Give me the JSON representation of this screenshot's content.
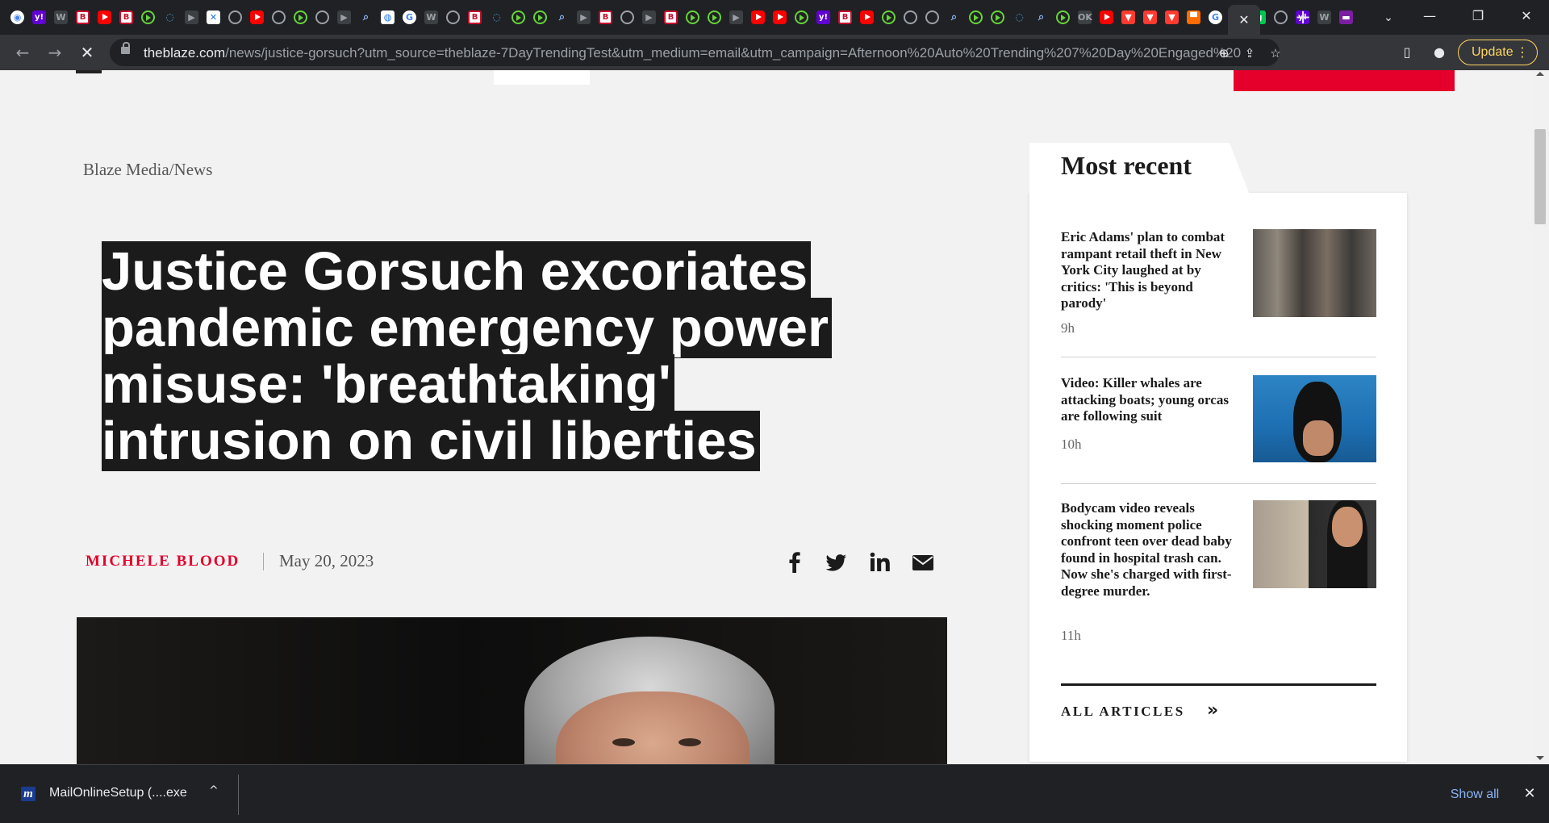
{
  "browser": {
    "tab_favicons": [
      "chrome",
      "yahoo",
      "wsj",
      "blaze",
      "youtube",
      "blaze",
      "rumble",
      "shield",
      "dark",
      "maps",
      "globe",
      "youtube",
      "globe",
      "rumble",
      "globe",
      "dark",
      "search",
      "earth",
      "google",
      "wsj",
      "globe",
      "blaze",
      "shield",
      "rumble",
      "rumble",
      "search",
      "dark",
      "blaze",
      "globe",
      "dark",
      "blaze",
      "rumble",
      "rumble",
      "dark",
      "youtube",
      "youtube",
      "rumble",
      "yahoo",
      "blaze",
      "youtube",
      "rumble",
      "globe",
      "globe",
      "search",
      "rumble",
      "rumble",
      "shield",
      "search",
      "rumble",
      "ok",
      "youtube",
      "dailymail",
      "dailymail",
      "dailymail",
      "orange",
      "google",
      "black",
      "green",
      "globe",
      "yahoo",
      "wsj",
      "purple"
    ],
    "active_tab_close": "✕",
    "new_tab": "+",
    "tab_search": "⌄",
    "window_controls": {
      "minimize": "—",
      "restore": "❐",
      "close": "✕"
    },
    "nav": {
      "back": "←",
      "forward": "→",
      "stop": "✕"
    },
    "url": {
      "domain": "theblaze.com",
      "path": "/news/justice-gorsuch?utm_source=theblaze-7DayTrendingTest&utm_medium=email&utm_campaign=Afternoon%20Auto%20Trending%207%20Day%20Engaged%202..."
    },
    "omnibox_icons": [
      "zoom-icon",
      "share-icon",
      "bookmark-star-icon"
    ],
    "toolbar_icons": [
      "side-panel-icon",
      "profile-icon"
    ],
    "update_label": "Update",
    "menu_dots": "⋮"
  },
  "article": {
    "breadcrumb": "Blaze Media/News",
    "headline": "Justice Gorsuch excoriates pandemic emergency power misuse:  'breathtaking' intrusion on civil liberties",
    "author": "Michele Blood",
    "date": "May 20, 2023",
    "share_icons": [
      "facebook-icon",
      "twitter-icon",
      "linkedin-icon",
      "email-icon"
    ]
  },
  "sidebar": {
    "title": "Most recent",
    "items": [
      {
        "title": "Eric Adams' plan to combat rampant retail theft in New York City laughed at by critics: 'This is beyond parody'",
        "time": "9h"
      },
      {
        "title": "Video: Killer whales are attacking boats; young orcas are following suit",
        "time": "10h"
      },
      {
        "title": "Bodycam video reveals shocking moment police confront teen over dead baby found in hospital trash can. Now she's charged with first-degree murder.",
        "time": "11h"
      }
    ],
    "all_articles": "ALL ARTICLES",
    "all_articles_chevron": "»"
  },
  "download_bar": {
    "file_name": "MailOnlineSetup (....exe",
    "icon_letter": "m",
    "chevron": "^",
    "show_all": "Show all",
    "close": "✕"
  },
  "colors": {
    "accent_red": "#e4002b",
    "headline_bg": "#1b1b1b",
    "page_bg": "#f2f2f2",
    "update_yellow": "#fdd663"
  }
}
